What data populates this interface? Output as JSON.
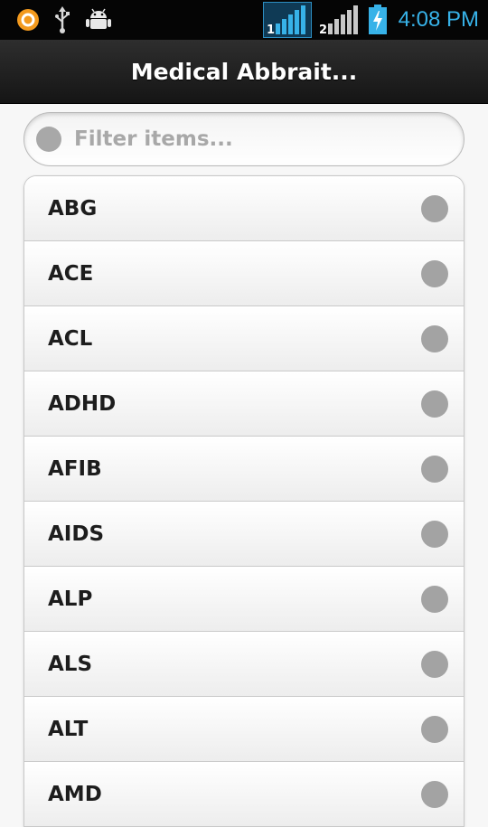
{
  "status_bar": {
    "time": "4:08 PM",
    "icons": [
      "app-notification-icon",
      "usb-icon",
      "android-debug-icon",
      "sim1-signal-icon",
      "sim2-signal-icon",
      "battery-charging-icon"
    ],
    "sim1_label": "1",
    "sim2_label": "2",
    "accent_color": "#37b2e8"
  },
  "header": {
    "title": "Medical Abbrait..."
  },
  "search": {
    "placeholder": "Filter items...",
    "value": ""
  },
  "list": {
    "items": [
      {
        "label": "ABG"
      },
      {
        "label": "ACE"
      },
      {
        "label": "ACL"
      },
      {
        "label": "ADHD"
      },
      {
        "label": "AFIB"
      },
      {
        "label": "AIDS"
      },
      {
        "label": "ALP"
      },
      {
        "label": "ALS"
      },
      {
        "label": "ALT"
      },
      {
        "label": "AMD"
      }
    ]
  }
}
